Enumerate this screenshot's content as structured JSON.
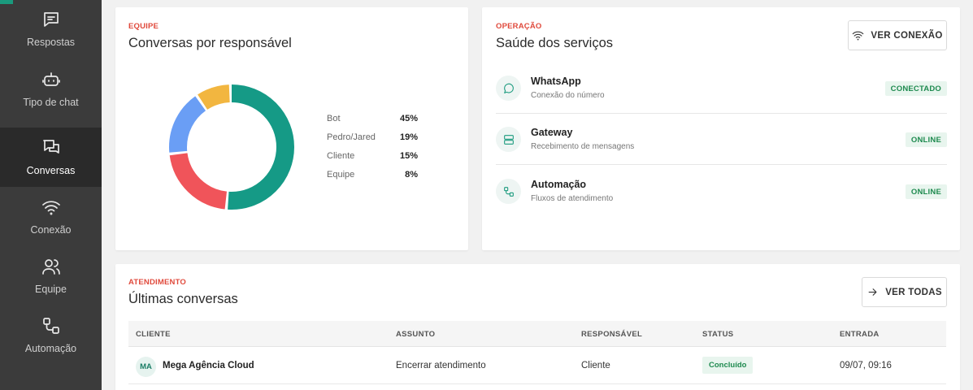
{
  "sidebar": {
    "items": [
      {
        "label": "Respostas",
        "icon": "message-square-icon"
      },
      {
        "label": "Tipo de chat",
        "icon": "bot-icon"
      },
      {
        "label": "Conversas",
        "icon": "conversations-icon",
        "active": true
      },
      {
        "label": "Conexão",
        "icon": "wifi-icon"
      },
      {
        "label": "Equipe",
        "icon": "users-icon"
      },
      {
        "label": "Automação",
        "icon": "workflow-icon"
      }
    ]
  },
  "team_card": {
    "eyebrow": "EQUIPE",
    "title": "Conversas por responsável",
    "chart_data": {
      "type": "pie",
      "donut": true,
      "categories": [
        "Bot",
        "Pedro/Jared",
        "Cliente",
        "Equipe"
      ],
      "values": [
        45,
        19,
        15,
        8
      ],
      "value_labels": [
        "45%",
        "19%",
        "15%",
        "8%"
      ],
      "colors": [
        "#159a86",
        "#f0545a",
        "#6a9ef5",
        "#f2b640"
      ],
      "legend_position": "right"
    }
  },
  "ops_card": {
    "eyebrow": "OPERAÇÃO",
    "title": "Saúde dos serviços",
    "button_label": "VER CONEXÃO",
    "services": [
      {
        "name": "WhatsApp",
        "desc": "Conexão do número",
        "status": "CONECTADO",
        "icon": "chat-bubble-icon"
      },
      {
        "name": "Gateway",
        "desc": "Recebimento de mensagens",
        "status": "ONLINE",
        "icon": "server-icon"
      },
      {
        "name": "Automação",
        "desc": "Fluxos de atendimento",
        "status": "ONLINE",
        "icon": "workflow-icon"
      }
    ]
  },
  "latest_card": {
    "eyebrow": "ATENDIMENTO",
    "title": "Últimas conversas",
    "button_label": "VER TODAS",
    "columns": [
      "CLIENTE",
      "ASSUNTO",
      "RESPONSÁVEL",
      "STATUS",
      "ENTRADA"
    ],
    "rows": [
      {
        "initials": "MA",
        "client": "Mega Agência Cloud",
        "subject": "Encerrar atendimento",
        "owner": "Cliente",
        "status": "Concluído",
        "entry": "09/07, 09:16"
      }
    ]
  },
  "colors": {
    "accent": "#1a9a7d",
    "eyebrow": "#e04a3c",
    "sidebar_bg": "#3b3b3b",
    "sidebar_active": "#2a2a2a",
    "status_green": "#1e8a4f"
  }
}
